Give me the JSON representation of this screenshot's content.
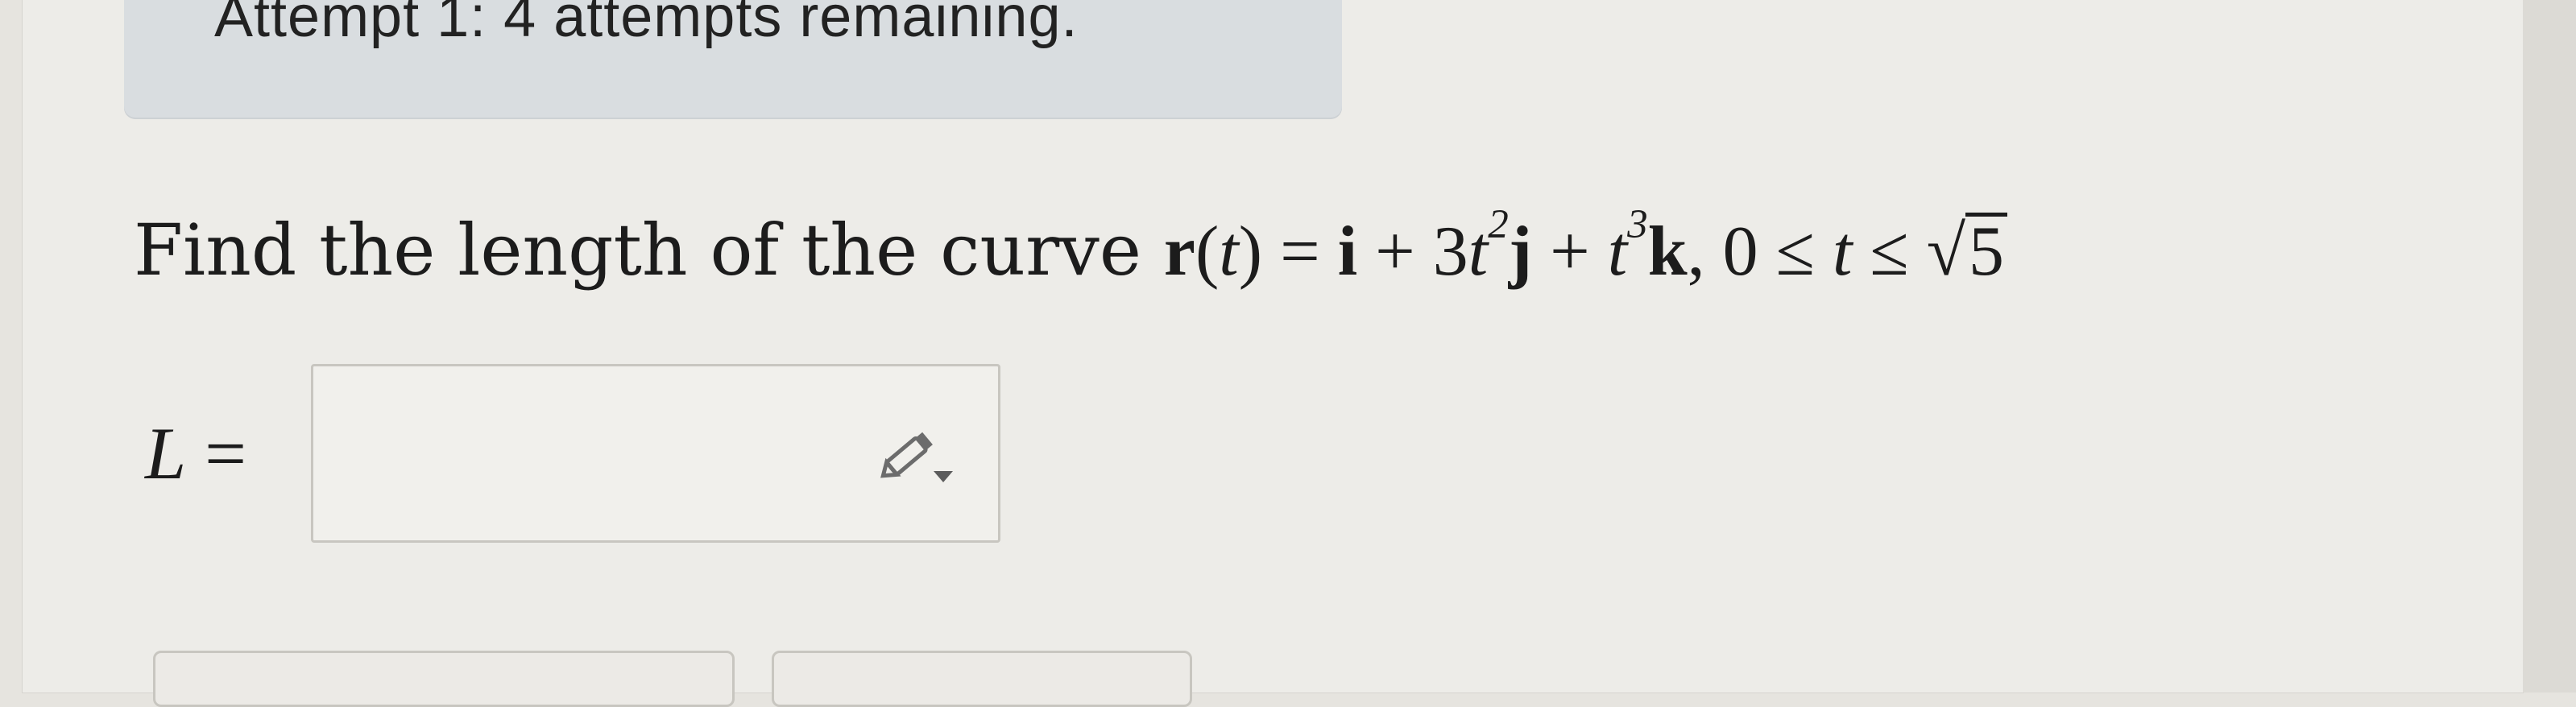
{
  "attempt": {
    "text": "Attempt 1: 4 attempts remaining."
  },
  "question": {
    "prefix": "Find the length of the curve ",
    "r": "r",
    "t_open": "(",
    "t": "t",
    "t_close": ")",
    "eq": " = ",
    "i": "i",
    "plus1": " + 3",
    "t2": "t",
    "exp2": "2",
    "j": "j",
    "plus2": " + ",
    "t3": "t",
    "exp3": "3",
    "k": "k",
    "comma": ", 0 ≤ ",
    "t4": "t",
    "le": " ≤ ",
    "sqrt_symbol": "√",
    "radicand": "5"
  },
  "answer": {
    "label_var": "L",
    "label_eq": " =",
    "value": ""
  },
  "icons": {
    "pencil": "pencil-dropdown-icon"
  }
}
